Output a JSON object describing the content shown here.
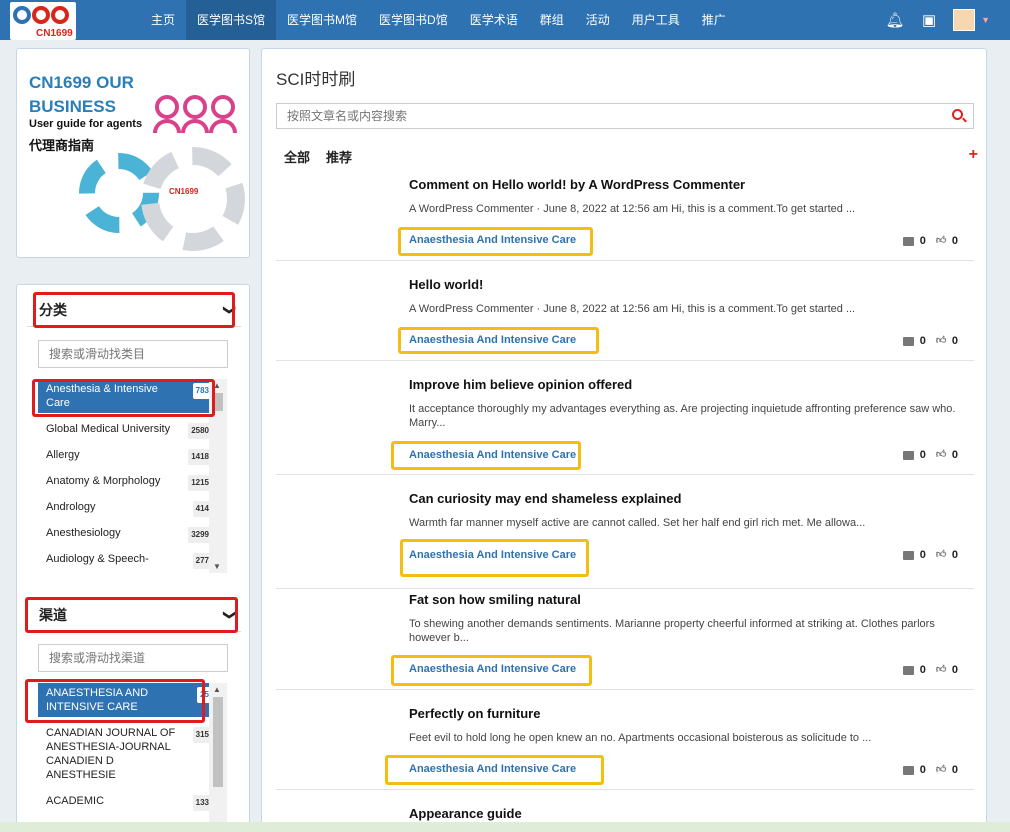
{
  "header": {
    "logo_text": "CN1699",
    "nav": [
      "主页",
      "医学图书S馆",
      "医学图书M馆",
      "医学图书D馆",
      "医学术语",
      "群组",
      "活动",
      "用户工具",
      "推广"
    ],
    "active_index": 1,
    "icons": [
      "bell-icon",
      "chat-icon",
      "avatar",
      "chevron-down-icon"
    ]
  },
  "banner": {
    "title_line1": "CN1699 OUR",
    "title_line2": "BUSINESS",
    "subtitle": "User guide for agents",
    "subtitle_cn": "代理商指南",
    "mini_logo": "CN1699"
  },
  "categories": {
    "heading": "分类",
    "placeholder": "搜索或滑动找类目",
    "items": [
      {
        "label": "Anesthesia & Intensive Care",
        "count": "783"
      },
      {
        "label": "Global Medical University",
        "count": "2580"
      },
      {
        "label": "Allergy",
        "count": "1418"
      },
      {
        "label": "Anatomy & Morphology",
        "count": "1215"
      },
      {
        "label": "Andrology",
        "count": "414"
      },
      {
        "label": "Anesthesiology",
        "count": "3299"
      },
      {
        "label": "Audiology & Speech-",
        "count": "277"
      }
    ]
  },
  "channels": {
    "heading": "渠道",
    "placeholder": "搜索或滑动找渠道",
    "items": [
      {
        "label": "ANAESTHESIA AND INTENSIVE CARE",
        "count": "25"
      },
      {
        "label": "CANADIAN JOURNAL OF ANESTHESIA-JOURNAL CANADIEN D ANESTHESIE",
        "count": "315"
      },
      {
        "label": "ACADEMIC",
        "count": "133"
      }
    ]
  },
  "main": {
    "title": "SCI时时刷",
    "search_placeholder": "按照文章名或内容搜索",
    "tabs": [
      "全部",
      "推荐"
    ],
    "add_label": "+"
  },
  "posts": [
    {
      "title": "Comment on Hello world! by A WordPress Commenter",
      "excerpt": "A WordPress Commenter · June 8, 2022 at 12:56 am Hi, this is a comment.To get started ...",
      "tag": "Anaesthesia And Intensive Care",
      "comments": "0",
      "likes": "0"
    },
    {
      "title": "Hello world!",
      "excerpt": "A WordPress Commenter · June 8, 2022 at 12:56 am Hi, this is a comment.To get started ...",
      "tag": "Anaesthesia And Intensive Care",
      "comments": "0",
      "likes": "0"
    },
    {
      "title": "Improve him believe opinion offered",
      "excerpt": "It acceptance thoroughly my advantages everything as. Are projecting inquietude affronting preference saw who. Marry...",
      "tag": "Anaesthesia And Intensive Care",
      "comments": "0",
      "likes": "0"
    },
    {
      "title": "Can curiosity may end shameless explained",
      "excerpt": "Warmth far manner myself active are cannot called. Set her half end girl rich met. Me allowa...",
      "tag": "Anaesthesia And Intensive Care",
      "comments": "0",
      "likes": "0"
    },
    {
      "title": "Fat son how smiling natural",
      "excerpt": "To shewing another demands sentiments. Marianne property cheerful informed at striking at. Clothes parlors however b...",
      "tag": "Anaesthesia And Intensive Care",
      "comments": "0",
      "likes": "0"
    },
    {
      "title": "Perfectly on furniture",
      "excerpt": "Feet evil to hold long he open knew an no. Apartments occasional boisterous as solicitude to ...",
      "tag": "Anaesthesia And Intensive Care",
      "comments": "0",
      "likes": "0"
    },
    {
      "title": "Appearance guide",
      "excerpt": "",
      "tag": "",
      "comments": "",
      "likes": ""
    }
  ],
  "colors": {
    "nav": "#2f72b1",
    "accent_red": "#d7261b",
    "highlight_yellow": "#f5bc12"
  }
}
